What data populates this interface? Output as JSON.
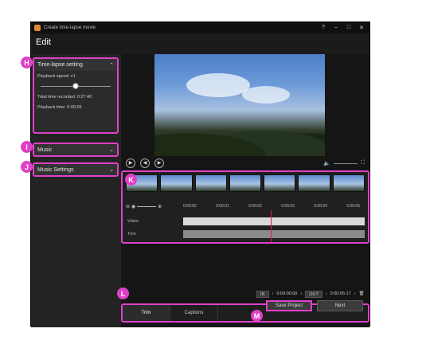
{
  "window": {
    "title": "Create time-lapse movie",
    "controls": [
      "?",
      "–",
      "□",
      "✕"
    ]
  },
  "header": {
    "title": "Edit"
  },
  "sidebar": {
    "timelapse": {
      "label": "Time-lapse setting",
      "playback_speed": "Playback speed: x1",
      "speed_level": 0.5,
      "total_time": "Total time recorded: 0:27:40",
      "playback_time": "Playback time: 0:00:05"
    },
    "music": {
      "label": "Music"
    },
    "music_settings": {
      "label": "Music Settings"
    }
  },
  "markers": {
    "h": "H",
    "i": "I",
    "j": "J",
    "k": "K",
    "l": "L",
    "m": "M"
  },
  "timeline": {
    "ticks": [
      "0:00:00",
      "0:00:01",
      "0:00:02",
      "0:00:03",
      "0:00:04",
      "0:00:05"
    ],
    "tracks": {
      "video": "Video",
      "trim": "Trim"
    }
  },
  "inout": {
    "in_label": "IN",
    "in_time": "0:00:00:00",
    "out_label": "OUT",
    "out_time": "0:00:05:17"
  },
  "tabs": [
    "Trim",
    "Captions"
  ],
  "footer": {
    "save_label": "Save Project",
    "next_label": "Next"
  },
  "colors": {
    "highlight": "#e040c8",
    "playhead": "#e0115f"
  }
}
